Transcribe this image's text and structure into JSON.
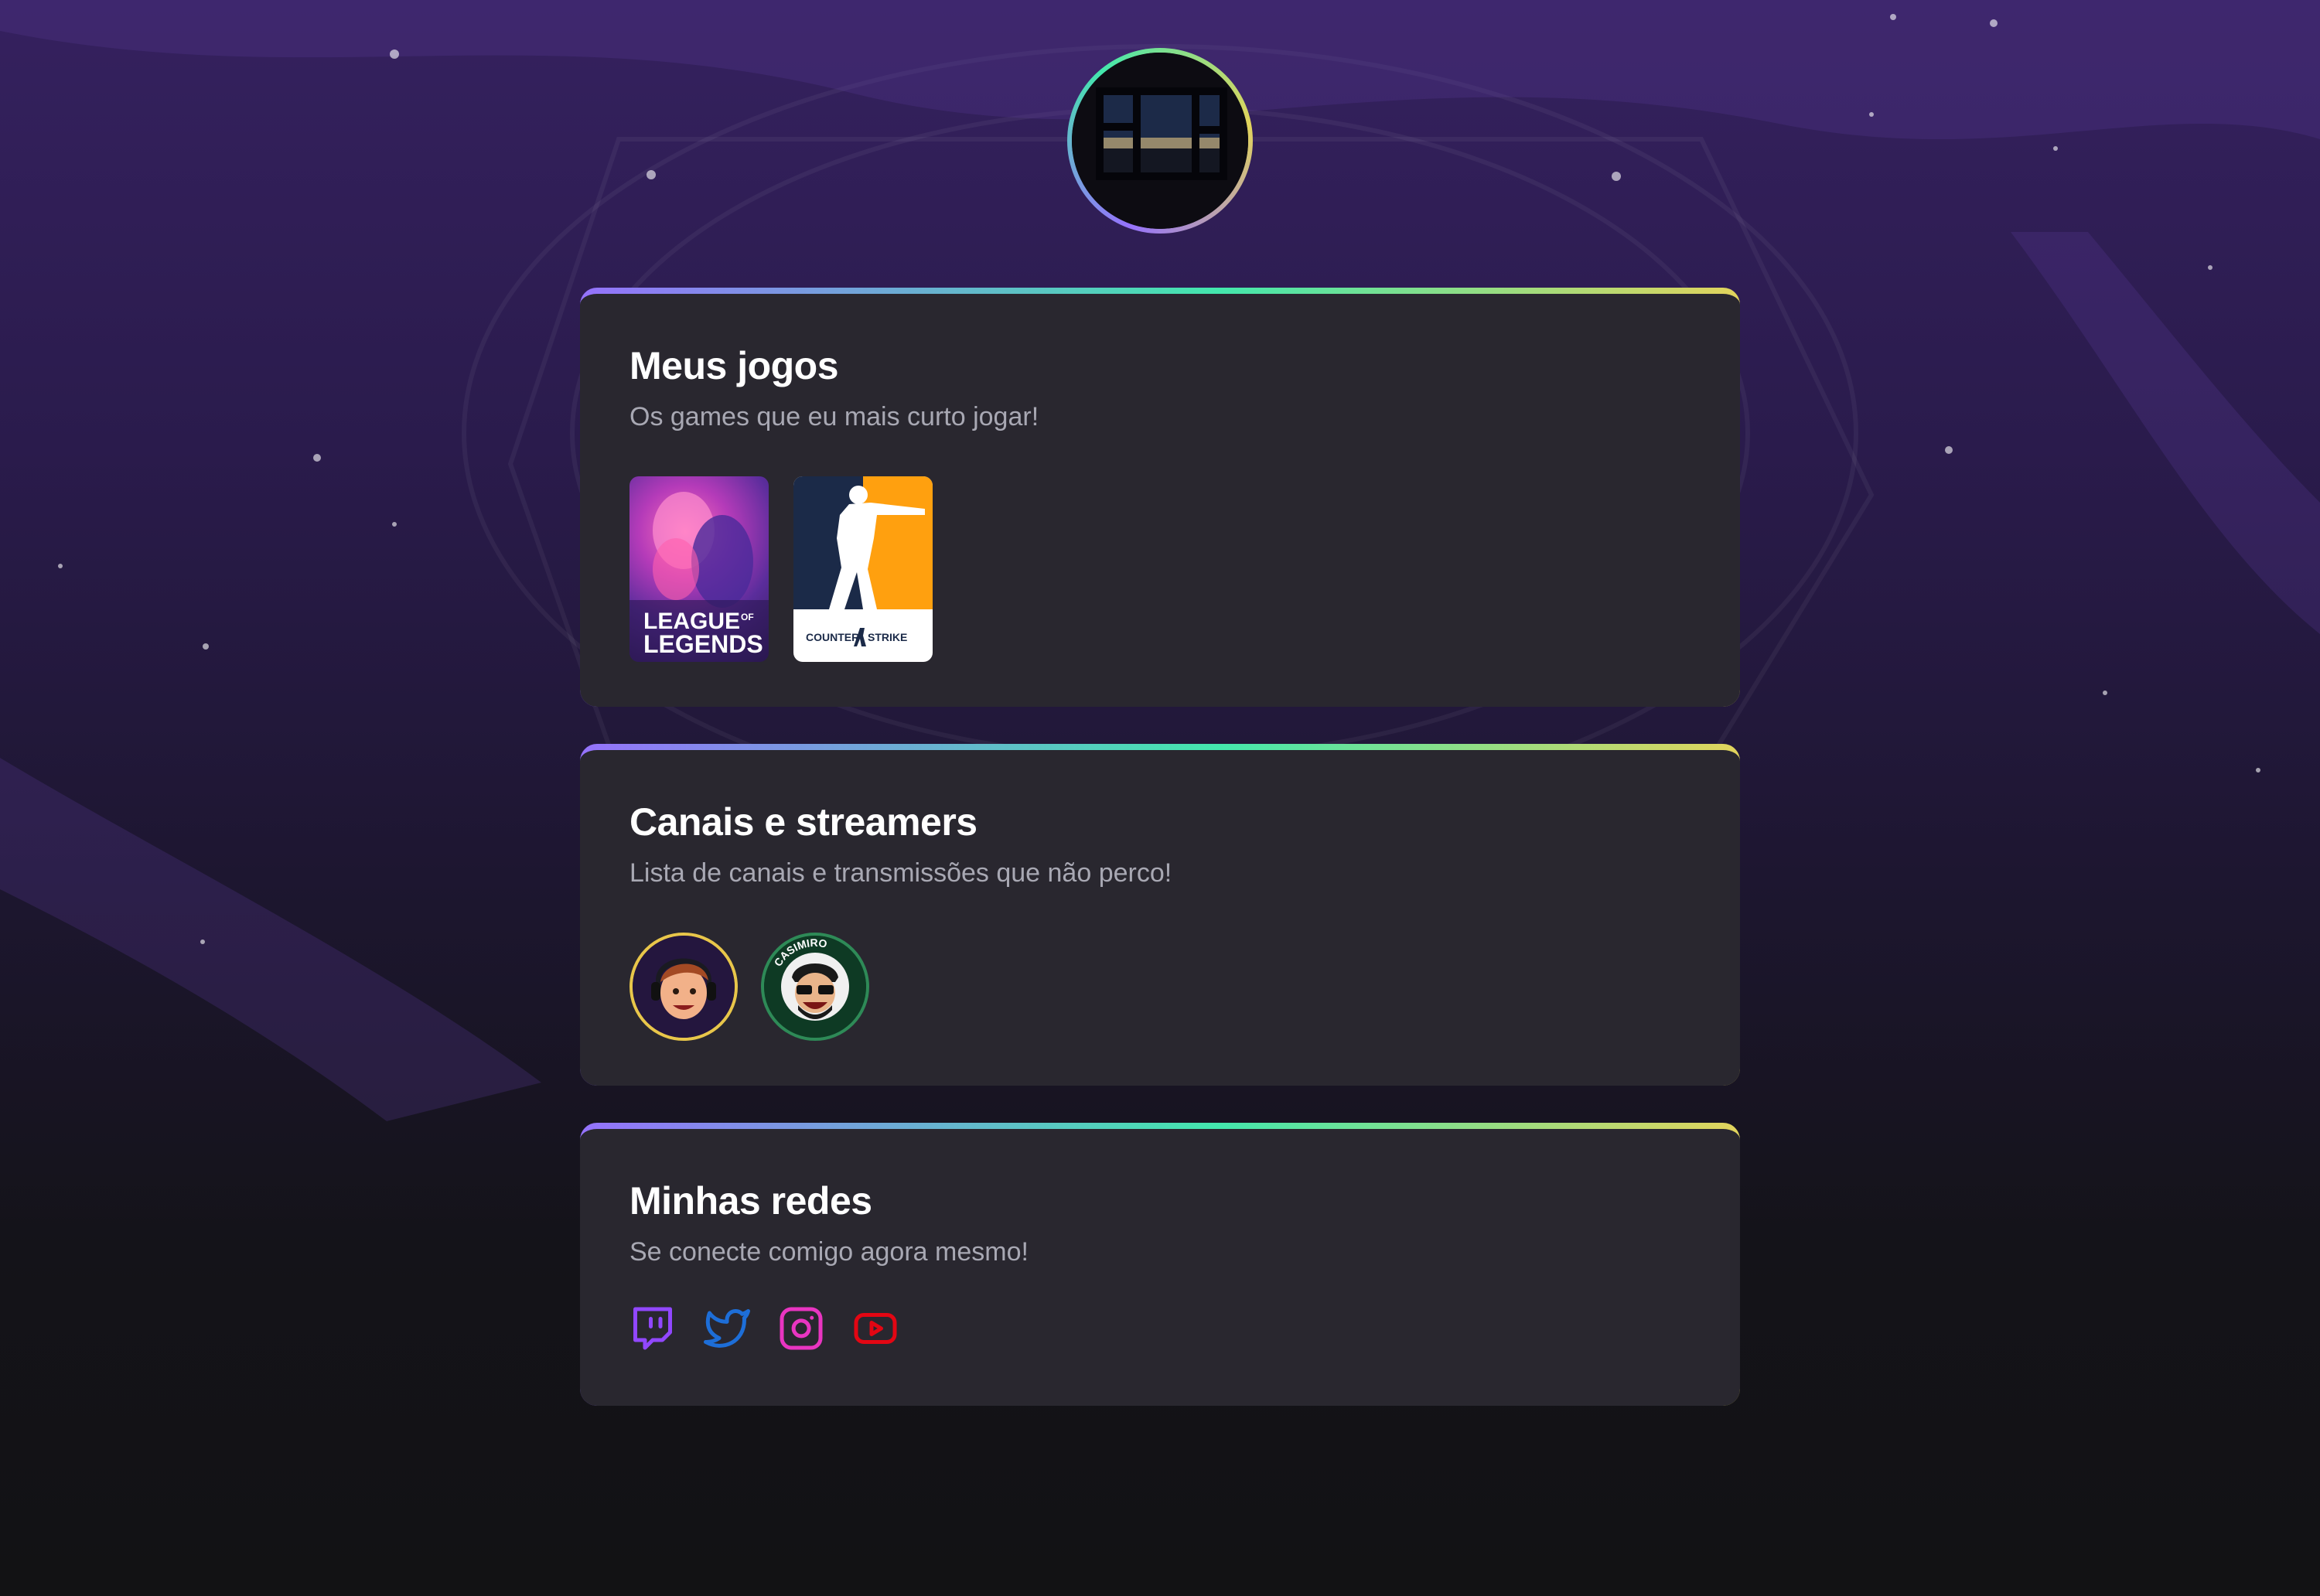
{
  "profile": {
    "avatar_icon": "profile-photo"
  },
  "sections": {
    "games": {
      "title": "Meus jogos",
      "subtitle": "Os games que eu mais curto jogar!",
      "items": [
        {
          "name_line1": "LEAGUE",
          "name_of": "OF",
          "name_line2": "LEGENDS"
        },
        {
          "name_line1": "COUNTER",
          "name_line2": "STRIKE"
        }
      ]
    },
    "streamers": {
      "title": "Canais e streamers",
      "subtitle": "Lista de canais e transmissões que não perco!",
      "items": [
        {
          "icon": "streamer-avatar"
        },
        {
          "ring_text": "CASIMIRO"
        }
      ]
    },
    "socials": {
      "title": "Minhas redes",
      "subtitle": "Se conecte comigo agora mesmo!",
      "items": [
        {
          "icon": "twitch-icon",
          "color": "#9147ff"
        },
        {
          "icon": "twitter-icon",
          "color": "#1d6ed8"
        },
        {
          "icon": "instagram-icon",
          "color": "#e935c1"
        },
        {
          "icon": "youtube-icon",
          "color": "#e30613"
        }
      ]
    }
  },
  "colors": {
    "accent_gradient": [
      "#9572fc",
      "#43e7ad",
      "#e2d45c"
    ],
    "card_bg": "#29272f",
    "subtitle": "#a8a8b3"
  }
}
